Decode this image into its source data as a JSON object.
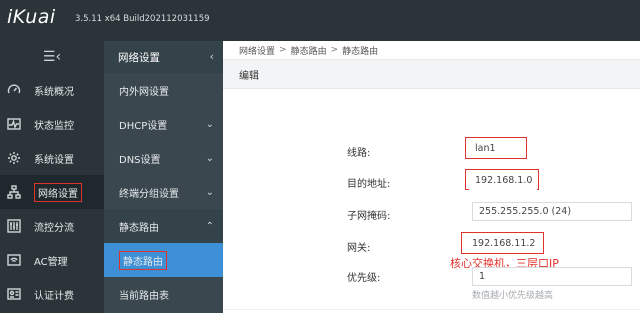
{
  "header": {
    "logo": "iKuai",
    "version": "3.5.11 x64 Build202112031159"
  },
  "sidebar": {
    "toggle_icon": "menu-collapse-icon",
    "items": [
      {
        "label": "系统概况",
        "icon": "speedometer-icon"
      },
      {
        "label": "状态监控",
        "icon": "pulse-icon"
      },
      {
        "label": "系统设置",
        "icon": "gear-icon"
      },
      {
        "label": "网络设置",
        "icon": "network-icon",
        "active": true
      },
      {
        "label": "流控分流",
        "icon": "sliders-icon"
      },
      {
        "label": "AC管理",
        "icon": "wifi-router-icon"
      },
      {
        "label": "认证计费",
        "icon": "id-card-icon"
      }
    ]
  },
  "subnav": {
    "title": "网络设置",
    "items": [
      {
        "label": "内外网设置",
        "chevron": false
      },
      {
        "label": "DHCP设置",
        "chevron": true
      },
      {
        "label": "DNS设置",
        "chevron": true
      },
      {
        "label": "终端分组设置",
        "chevron": true
      },
      {
        "label": "静态路由",
        "chevron": true,
        "open": true
      },
      {
        "label": "静态路由",
        "chevron": false,
        "selected": true
      },
      {
        "label": "当前路由表",
        "chevron": false
      }
    ]
  },
  "breadcrumb": [
    "网络设置",
    "静态路由",
    "静态路由"
  ],
  "breadcrumb_sep": ">",
  "section_title": "编辑",
  "form": {
    "line": {
      "label": "线路:",
      "value": "lan1"
    },
    "dest": {
      "label": "目的地址:",
      "value": "192.168.1.0"
    },
    "mask": {
      "label": "子网掩码:",
      "value": "255.255.255.0 (24)"
    },
    "gateway": {
      "label": "网关:",
      "value": "192.168.11.2"
    },
    "priority": {
      "label": "优先级:",
      "value": "1",
      "hint": "数值越小优先级越高"
    }
  },
  "annotation": "核心交换机，三层口IP",
  "colors": {
    "annotation": "#e0312b",
    "selected": "#3d8fd6",
    "sidebar": "#2a3439"
  }
}
